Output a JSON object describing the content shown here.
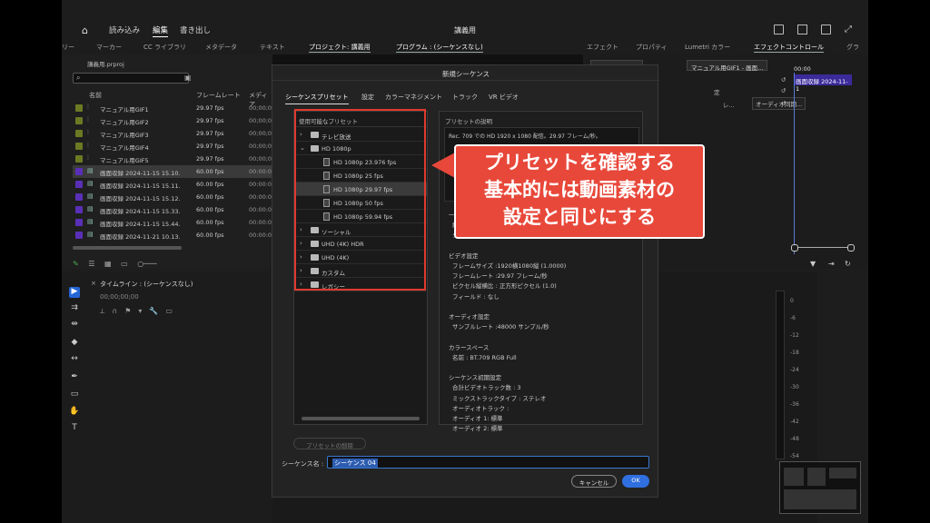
{
  "app": {
    "nav": [
      "読み込み",
      "編集",
      "書き出し"
    ],
    "active_nav": 1,
    "title": "講義用"
  },
  "left_tabs": [
    "リー",
    "マーカー",
    "CC ライブラリ",
    "メタデータ",
    "テキスト",
    "プロジェクト: 講義用"
  ],
  "program_tab": "プログラム : (シーケンスなし)",
  "right_tabs": [
    "エフェクト",
    "プロパティ",
    "Lumetri カラー",
    "エフェクトコントロール",
    "グラ"
  ],
  "project": {
    "file_name": "講義用.prproj",
    "columns": [
      "名前",
      "フレームレート",
      "メディア"
    ],
    "items": [
      {
        "name": "マニュアル用GIF1",
        "fps": "29.97 fps",
        "tc": "00;00;00",
        "color": "#6b7a23",
        "kind": "seq"
      },
      {
        "name": "マニュアル用GIF2",
        "fps": "29.97 fps",
        "tc": "00;00;00",
        "color": "#6b7a23",
        "kind": "seq"
      },
      {
        "name": "マニュアル用GIF3",
        "fps": "29.97 fps",
        "tc": "00;00;00",
        "color": "#6b7a23",
        "kind": "seq"
      },
      {
        "name": "マニュアル用GIF4",
        "fps": "29.97 fps",
        "tc": "00;00;00",
        "color": "#6b7a23",
        "kind": "seq"
      },
      {
        "name": "マニュアル用GIF5",
        "fps": "29.97 fps",
        "tc": "00;00;00",
        "color": "#6b7a23",
        "kind": "seq"
      },
      {
        "name": "画面収録 2024-11-15 15.10.",
        "fps": "60.00 fps",
        "tc": "00:00:00",
        "color": "#5a2fb8",
        "kind": "clip"
      },
      {
        "name": "画面収録 2024-11-15 15.11.",
        "fps": "60.00 fps",
        "tc": "00:00:00",
        "color": "#5a2fb8",
        "kind": "clip"
      },
      {
        "name": "画面収録 2024-11-15 15.12.",
        "fps": "60.00 fps",
        "tc": "00:00:00",
        "color": "#5a2fb8",
        "kind": "clip"
      },
      {
        "name": "画面収録 2024-11-15 15.33.",
        "fps": "60.00 fps",
        "tc": "00:00:00",
        "color": "#5a2fb8",
        "kind": "clip"
      },
      {
        "name": "画面収録 2024-11-15 15.44.",
        "fps": "60.00 fps",
        "tc": "00:00:00",
        "color": "#5a2fb8",
        "kind": "clip"
      },
      {
        "name": "画面収録 2024-11-21 10.13.",
        "fps": "60.00 fps",
        "tc": "00:00:00",
        "color": "#5a2fb8",
        "kind": "clip"
      }
    ]
  },
  "timeline": {
    "label": "タイムライン : (シーケンスなし)",
    "timecode": "00;00;00;00"
  },
  "effect_controls": {
    "tab1": "シ... ... ...ム 2...",
    "tab2": "マニュアル用GIF1 - 画面...",
    "label_a": "定",
    "label_b": "レ...",
    "dropdown": "オーディオ同期...",
    "clip_label": "画面収録 2024-11-1",
    "timecode": "00:00"
  },
  "meter": {
    "db_labels": [
      "0",
      "-6",
      "-12",
      "-18",
      "-24",
      "-30",
      "-36",
      "-42",
      "-48",
      "-54"
    ]
  },
  "dialog": {
    "title": "新規シーケンス",
    "tabs": [
      "シーケンスプリセット",
      "設定",
      "カラーマネジメント",
      "トラック",
      "VR ビデオ"
    ],
    "active_tab": 0,
    "available_presets": "使用可能なプリセット",
    "presets": [
      {
        "label": "テレビ放送",
        "level": 0,
        "type": "folder",
        "expanded": false
      },
      {
        "label": "HD 1080p",
        "level": 0,
        "type": "folder",
        "expanded": true
      },
      {
        "label": "HD 1080p 23.976 fps",
        "level": 1,
        "type": "preset"
      },
      {
        "label": "HD 1080p 25 fps",
        "level": 1,
        "type": "preset"
      },
      {
        "label": "HD 1080p 29.97 fps",
        "level": 1,
        "type": "preset",
        "selected": true
      },
      {
        "label": "HD 1080p 50 fps",
        "level": 1,
        "type": "preset"
      },
      {
        "label": "HD 1080p 59.94 fps",
        "level": 1,
        "type": "preset"
      },
      {
        "label": "ソーシャル",
        "level": 0,
        "type": "folder",
        "expanded": false
      },
      {
        "label": "UHD (4K) HDR",
        "level": 0,
        "type": "folder",
        "expanded": false
      },
      {
        "label": "UHD (4K)",
        "level": 0,
        "type": "folder",
        "expanded": false
      },
      {
        "label": "カスタム",
        "level": 0,
        "type": "folder",
        "expanded": false
      },
      {
        "label": "レガシー",
        "level": 0,
        "type": "folder",
        "expanded": false
      }
    ],
    "description_label": "プリセットの説明",
    "description_text": "Rec. 709 での HD 1920 x 1080 配信。29.97 フレーム/秒。",
    "details": [
      "一般",
      "編集モード",
      "タイムベ",
      "",
      "ビデオ設定",
      "フレームサイズ :1920横1080縦 (1.0000)",
      "フレームレート :29.97 フレーム/秒",
      "ピクセル縦横比 : 正方形ピクセル (1.0)",
      "フィールド : なし",
      "",
      "オーディオ設定",
      "サンプルレート :48000 サンプル/秒",
      "",
      "カラースペース",
      "名前 : BT.709 RGB Full",
      "",
      "シーケンス初期設定",
      "合計ビデオトラック数 : 3",
      "ミックストラックタイプ : ステレオ",
      "オーディオトラック :",
      "オーディオ 1: 標準",
      "オーディオ 2: 標準"
    ],
    "delete_preset": "プリセットの削除",
    "sequence_name_label": "シーケンス名 :",
    "sequence_name_value": "シーケンス 04",
    "cancel": "キャンセル",
    "ok": "OK"
  },
  "callout": {
    "lines": [
      "プリセットを確認する",
      "基本的には動画素材の",
      "設定と同じにする"
    ],
    "color": "#e8483a"
  }
}
